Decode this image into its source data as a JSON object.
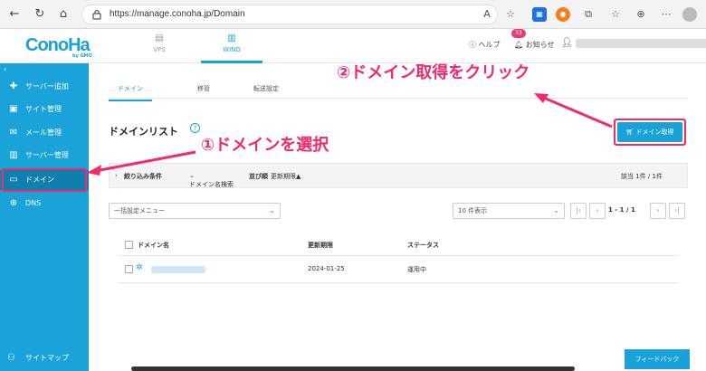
{
  "browser": {
    "url": "https://manage.conoha.jp/Domain",
    "badge_count": "33"
  },
  "header": {
    "logo": "ConoHa",
    "logo_sub": "by GMO",
    "tabs": [
      {
        "label": "VPS",
        "icon": "server-icon"
      },
      {
        "label": "WING",
        "icon": "wing-icon"
      }
    ],
    "help_label": "ヘルプ",
    "notice_label": "お知らせ"
  },
  "sidebar": {
    "items": [
      {
        "label": "サーバー追加",
        "icon": "plus-icon"
      },
      {
        "label": "サイト管理",
        "icon": "site-icon"
      },
      {
        "label": "メール管理",
        "icon": "mail-icon"
      },
      {
        "label": "サーバー管理",
        "icon": "server-icon"
      },
      {
        "label": "ドメイン",
        "icon": "domain-icon"
      },
      {
        "label": "DNS",
        "icon": "globe-icon"
      }
    ],
    "sitemap_label": "サイトマップ"
  },
  "main": {
    "tabs": [
      {
        "label": "ドメイン"
      },
      {
        "label": "移管"
      },
      {
        "label": "転送設定"
      }
    ],
    "page_title": "ドメインリスト",
    "get_domain_button": "ドメイン取得",
    "filter": {
      "label": "絞り込み条件",
      "search": "ドメイン名検索",
      "sort_label": "並び順",
      "sort_value": "更新期限▲",
      "count": "該当 1件 / 1件"
    },
    "bulk_menu": "一括設定メニュー",
    "per_page": "10 件表示",
    "pagination": "1 - 1 / 1",
    "table": {
      "headers": [
        "ドメイン名",
        "更新期限",
        "ステータス"
      ],
      "rows": [
        {
          "expiry": "2024-01-25",
          "status": "運用中"
        }
      ]
    },
    "feedback": "フィードバック"
  },
  "annotations": {
    "step1": "①ドメインを選択",
    "step2": "②ドメイン取得をクリック"
  },
  "colors": {
    "brand": "#19a1d9",
    "annotation": "#f4286a"
  }
}
